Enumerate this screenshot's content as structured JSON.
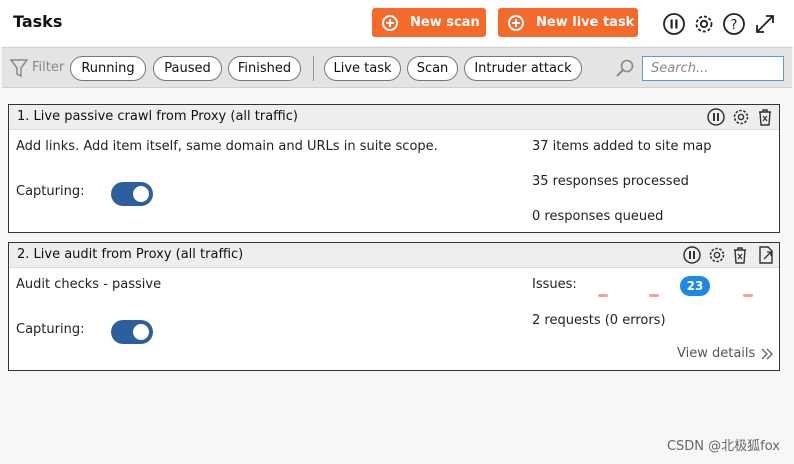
{
  "header": {
    "title": "Tasks",
    "new_scan": "New scan",
    "new_live_task": "New live task"
  },
  "filterbar": {
    "label": "Filter",
    "chips": [
      "Running",
      "Paused",
      "Finished",
      "Live task",
      "Scan",
      "Intruder attack"
    ],
    "search_placeholder": "Search..."
  },
  "tasks": [
    {
      "title": "1. Live passive crawl from Proxy (all traffic)",
      "description": "Add links. Add item itself, same domain and URLs in suite scope.",
      "capturing_label": "Capturing:",
      "stats": [
        "37 items added to site map",
        "35 responses processed",
        "0 responses queued"
      ]
    },
    {
      "title": "2. Live audit from Proxy (all traffic)",
      "description": "Audit checks - passive",
      "capturing_label": "Capturing:",
      "issues_label": "Issues:",
      "issues_count": "23",
      "requests": "2 requests (0 errors)",
      "view_details": "View details"
    }
  ],
  "watermark": "CSDN @北极狐fox"
}
